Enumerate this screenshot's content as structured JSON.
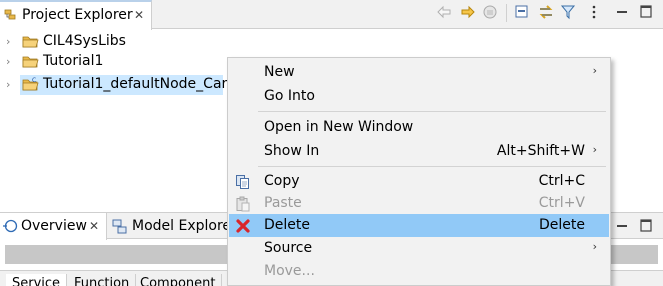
{
  "project_explorer": {
    "tab_title": "Project Explorer",
    "tab_icon": "project-explorer-icon",
    "toolbar_icons": [
      "back-arrow-icon",
      "forward-arrow-icon",
      "up-folder-icon",
      "collapse-all-icon",
      "link-with-editor-icon",
      "filter-icon",
      "view-menu-icon",
      "minimize-icon",
      "maximize-icon"
    ],
    "tree": [
      {
        "label": "CIL4SysLibs",
        "icon": "project-folder-icon",
        "selected": false
      },
      {
        "label": "Tutorial1",
        "icon": "project-folder-icon",
        "selected": false
      },
      {
        "label": "Tutorial1_defaultNode_Car",
        "icon": "c-project-folder-icon",
        "selected": true
      }
    ]
  },
  "lower_views": {
    "tabs": [
      {
        "label": "Overview",
        "icon": "overview-icon",
        "active": true
      },
      {
        "label": "Model Explorer",
        "icon": "model-explorer-icon",
        "active": false
      }
    ],
    "sub_tabs": [
      "Service",
      "Function",
      "Component"
    ]
  },
  "context_menu": {
    "items": [
      {
        "label": "New",
        "submenu": true
      },
      {
        "label": "Go Into"
      },
      {
        "separator": true
      },
      {
        "label": "Open in New Window"
      },
      {
        "label": "Show In",
        "accelerator": "Alt+Shift+W",
        "submenu": true
      },
      {
        "separator": true
      },
      {
        "label": "Copy",
        "accelerator": "Ctrl+C",
        "icon": "copy-icon"
      },
      {
        "label": "Paste",
        "accelerator": "Ctrl+V",
        "icon": "paste-icon",
        "disabled": true
      },
      {
        "label": "Delete",
        "accelerator": "Delete",
        "icon": "delete-icon",
        "highlighted": true
      },
      {
        "label": "Source",
        "submenu": true
      },
      {
        "label": "Move...",
        "disabled": true
      }
    ]
  },
  "colors": {
    "selection": "#cce8ff",
    "menu_highlight": "#91c9f7",
    "menu_background": "#f2f2f2",
    "delete_icon": "#d9262b",
    "folder_icon": "#e9b94b"
  }
}
